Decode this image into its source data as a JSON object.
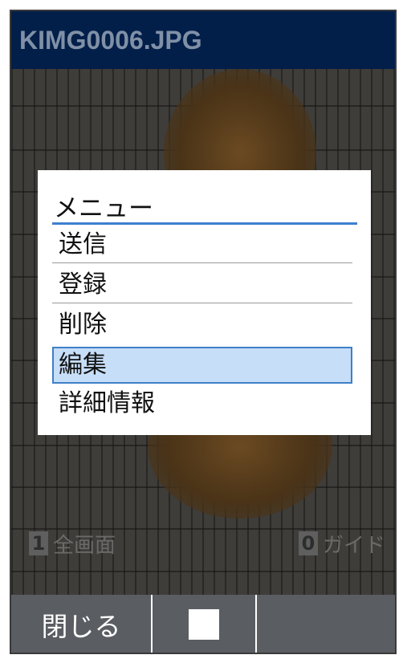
{
  "screen": {
    "title": "KIMG0006.JPG"
  },
  "menu": {
    "title": "メニュー",
    "items": [
      {
        "label": "送信",
        "selected": false
      },
      {
        "label": "登録",
        "selected": false
      },
      {
        "label": "削除",
        "selected": false
      },
      {
        "label": "編集",
        "selected": true
      },
      {
        "label": "詳細情報",
        "selected": false
      }
    ]
  },
  "hints": {
    "fullscreen": {
      "key": "1",
      "label": "全画面"
    },
    "guide": {
      "key": "0",
      "label": "ガイド"
    }
  },
  "softkeys": {
    "left_label": "閉じる",
    "center_icon": "stop-icon",
    "right_label": ""
  },
  "colors": {
    "title_bar": "#021f4a",
    "selection_fill": "#c7def8",
    "selection_border": "#3f7fc6",
    "accent_rule": "#3e7fd1",
    "softkey_bar": "#5a5d62"
  }
}
